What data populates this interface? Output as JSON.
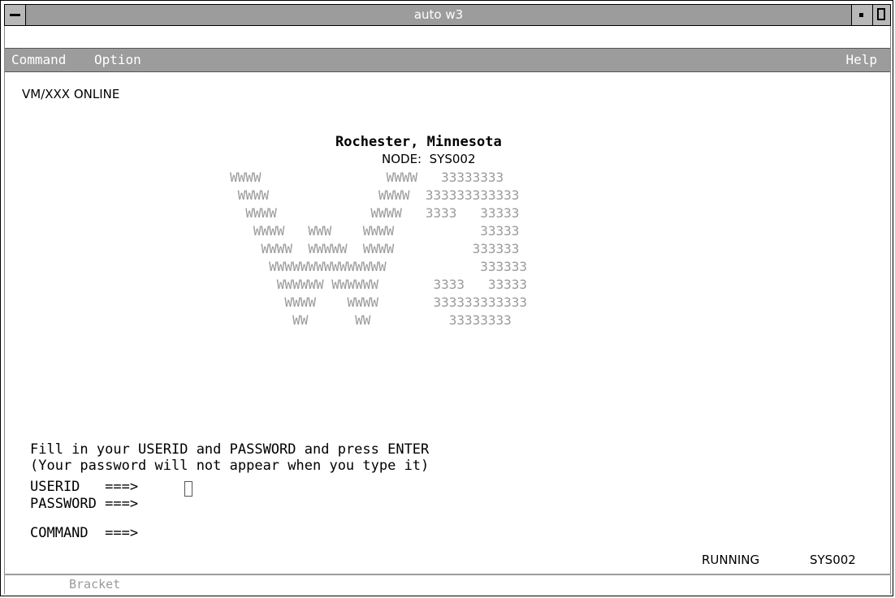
{
  "window": {
    "title": "auto w3"
  },
  "menubar": {
    "command": "Command",
    "option": "Option",
    "help": "Help"
  },
  "screen": {
    "header": "VM/XXX ONLINE",
    "location": "Rochester, Minnesota",
    "node": "NODE:  SYS002",
    "logo_lines": [
      "WWWW                WWWW   33333333",
      " WWWW              WWWW  333333333333",
      "  WWWW            WWWW   3333   33333",
      "   WWWW   WWW    WWWW           33333",
      "    WWWW  WWWWW  WWWW          333333",
      "     WWWWWWWWWWWWWWW            333333",
      "      WWWWWW WWWWWW       3333   33333",
      "       WWWW    WWWW       333333333333",
      "        WW      WW          33333333"
    ],
    "instruction1": "Fill in your USERID and PASSWORD and press ENTER",
    "instruction2": "(Your password will not appear when you type it)",
    "userid_label": "USERID   ===>",
    "userid_value": "",
    "password_label": "PASSWORD ===>",
    "command_label": "COMMAND  ===>",
    "status": "RUNNING",
    "system": "SYS002"
  },
  "statusbar": {
    "text": "Bracket"
  }
}
